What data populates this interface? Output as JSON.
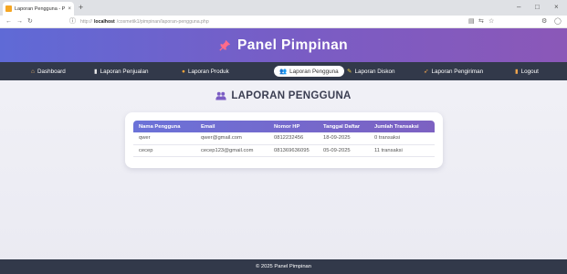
{
  "browser": {
    "tab_title": "Laporan Pengguna - Panel Pim",
    "tab_close": "×",
    "new_tab": "+",
    "url_host": "localhost",
    "url_path": "/cosmetik1/pimpinan/laporan-pengguna.php",
    "url_prefix": "http://",
    "win_minimize": "–",
    "win_maximize": "□",
    "win_close": "×",
    "icons": [
      "back-icon",
      "forward-icon",
      "reload-icon",
      "info-icon",
      "lock-icon",
      "reader-icon",
      "star-icon",
      "collections-icon",
      "profile-icon"
    ]
  },
  "header": {
    "title": "Panel Pimpinan",
    "icon": "pushpin-icon",
    "colors": {
      "start": "#5f6ad6",
      "end": "#8b58b8"
    }
  },
  "nav": {
    "items": [
      {
        "label": "Dashboard",
        "icon": "house-icon",
        "glyph": "⌂"
      },
      {
        "label": "Laporan Penjualan",
        "icon": "bars-icon",
        "glyph": "▮"
      },
      {
        "label": "Laporan Produk",
        "icon": "product-icon",
        "glyph": "●"
      },
      {
        "label": "Laporan Pengguna",
        "icon": "users-icon",
        "glyph": "👥",
        "active": true
      },
      {
        "label": "Laporan Diskon",
        "icon": "tag-icon",
        "glyph": "✎"
      },
      {
        "label": "Laporan Pengiriman",
        "icon": "truck-icon",
        "glyph": "➶"
      },
      {
        "label": "Logout",
        "icon": "door-icon",
        "glyph": "▮"
      }
    ]
  },
  "content": {
    "title": "LAPORAN PENGGUNA",
    "icon": "users-icon"
  },
  "table": {
    "headers": [
      "Nama Pengguna",
      "Email",
      "Nomor HP",
      "Tanggal Daftar",
      "Jumlah Transaksi"
    ],
    "rows": [
      [
        "qwer",
        "qwer@gmail.com",
        "0812232456",
        "18-09-2025",
        "0 transaksi"
      ],
      [
        "cecep",
        "cecep123@gmail.com",
        "081369636095",
        "05-09-2025",
        "11 transaksi"
      ]
    ]
  },
  "footer": {
    "text": "© 2025 Panel Pimpinan"
  }
}
